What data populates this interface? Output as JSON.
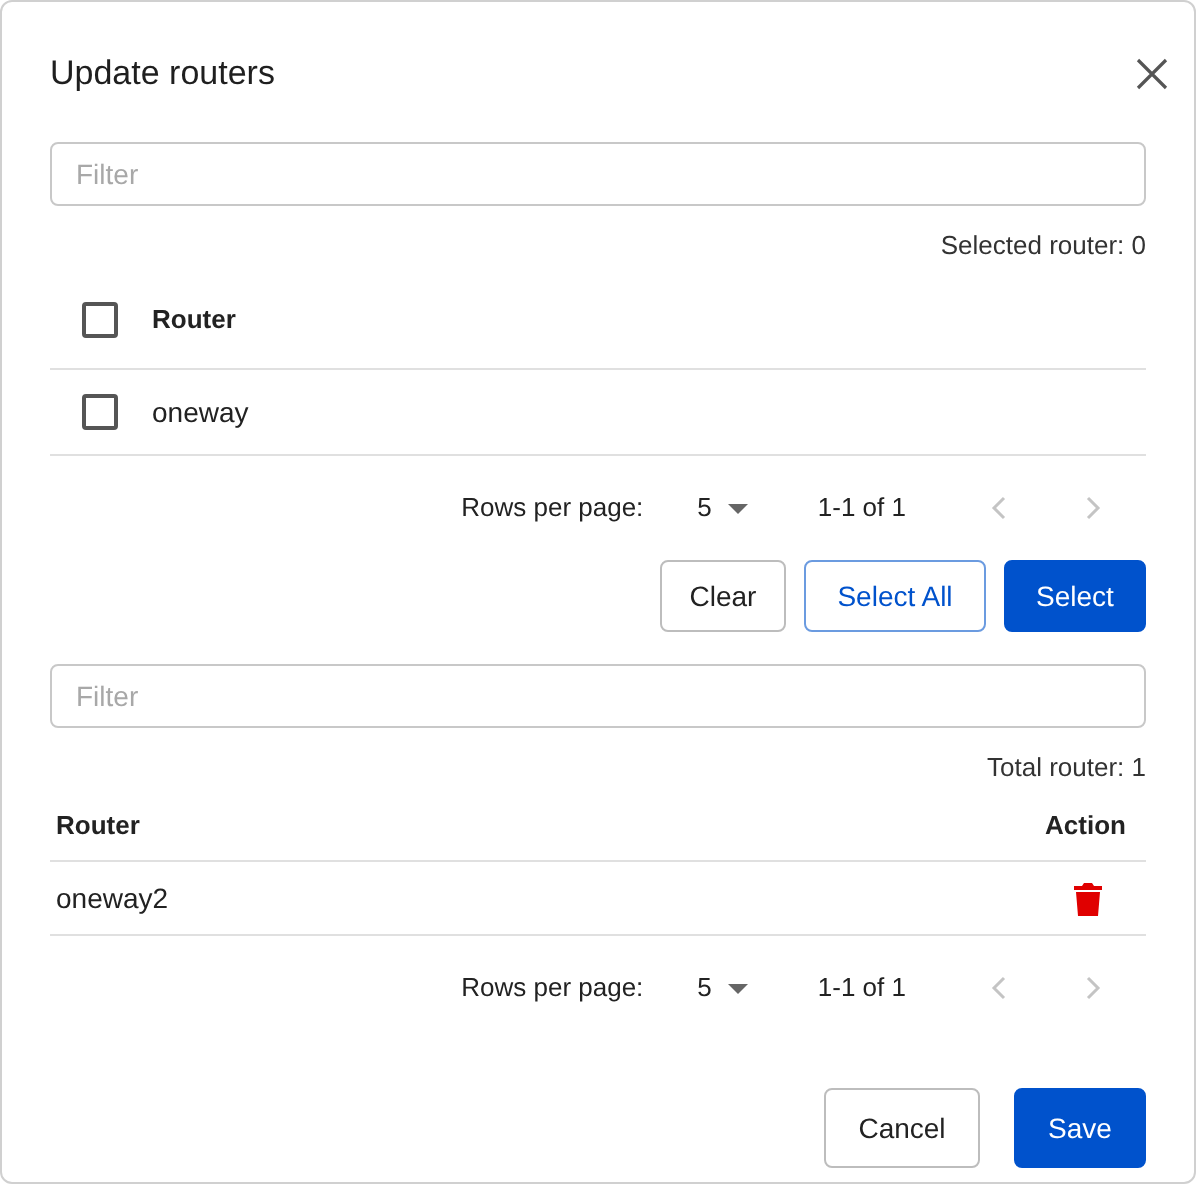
{
  "dialog": {
    "title": "Update routers"
  },
  "available": {
    "filter": {
      "placeholder": "Filter"
    },
    "selected_count": "Selected router: 0",
    "header": {
      "label": "Router",
      "checked": false
    },
    "rows": [
      {
        "name": "oneway",
        "checked": false
      }
    ],
    "pagination": {
      "rows_per_page_label": "Rows per page:",
      "rows_per_page": "5",
      "range": "1-1 of 1",
      "prev_disabled": true,
      "next_disabled": true
    }
  },
  "buttons": [
    {
      "label": "Clear",
      "kind": "default"
    },
    {
      "label": "Select All",
      "kind": "outline"
    },
    {
      "label": "Select",
      "kind": "primary"
    }
  ],
  "assigned": {
    "filter": {
      "placeholder": "Filter"
    },
    "total": "Total router: 1",
    "columns": [
      "Router",
      "Action"
    ],
    "rows": [
      {
        "name": "oneway2"
      }
    ],
    "pagination": {
      "rows_per_page_label": "Rows per page:",
      "rows_per_page": "5",
      "range": "1-1 of 1",
      "prev_disabled": true,
      "next_disabled": true
    }
  },
  "footer_buttons": [
    {
      "label": "Cancel",
      "kind": "default"
    },
    {
      "label": "Save",
      "kind": "primary"
    }
  ]
}
